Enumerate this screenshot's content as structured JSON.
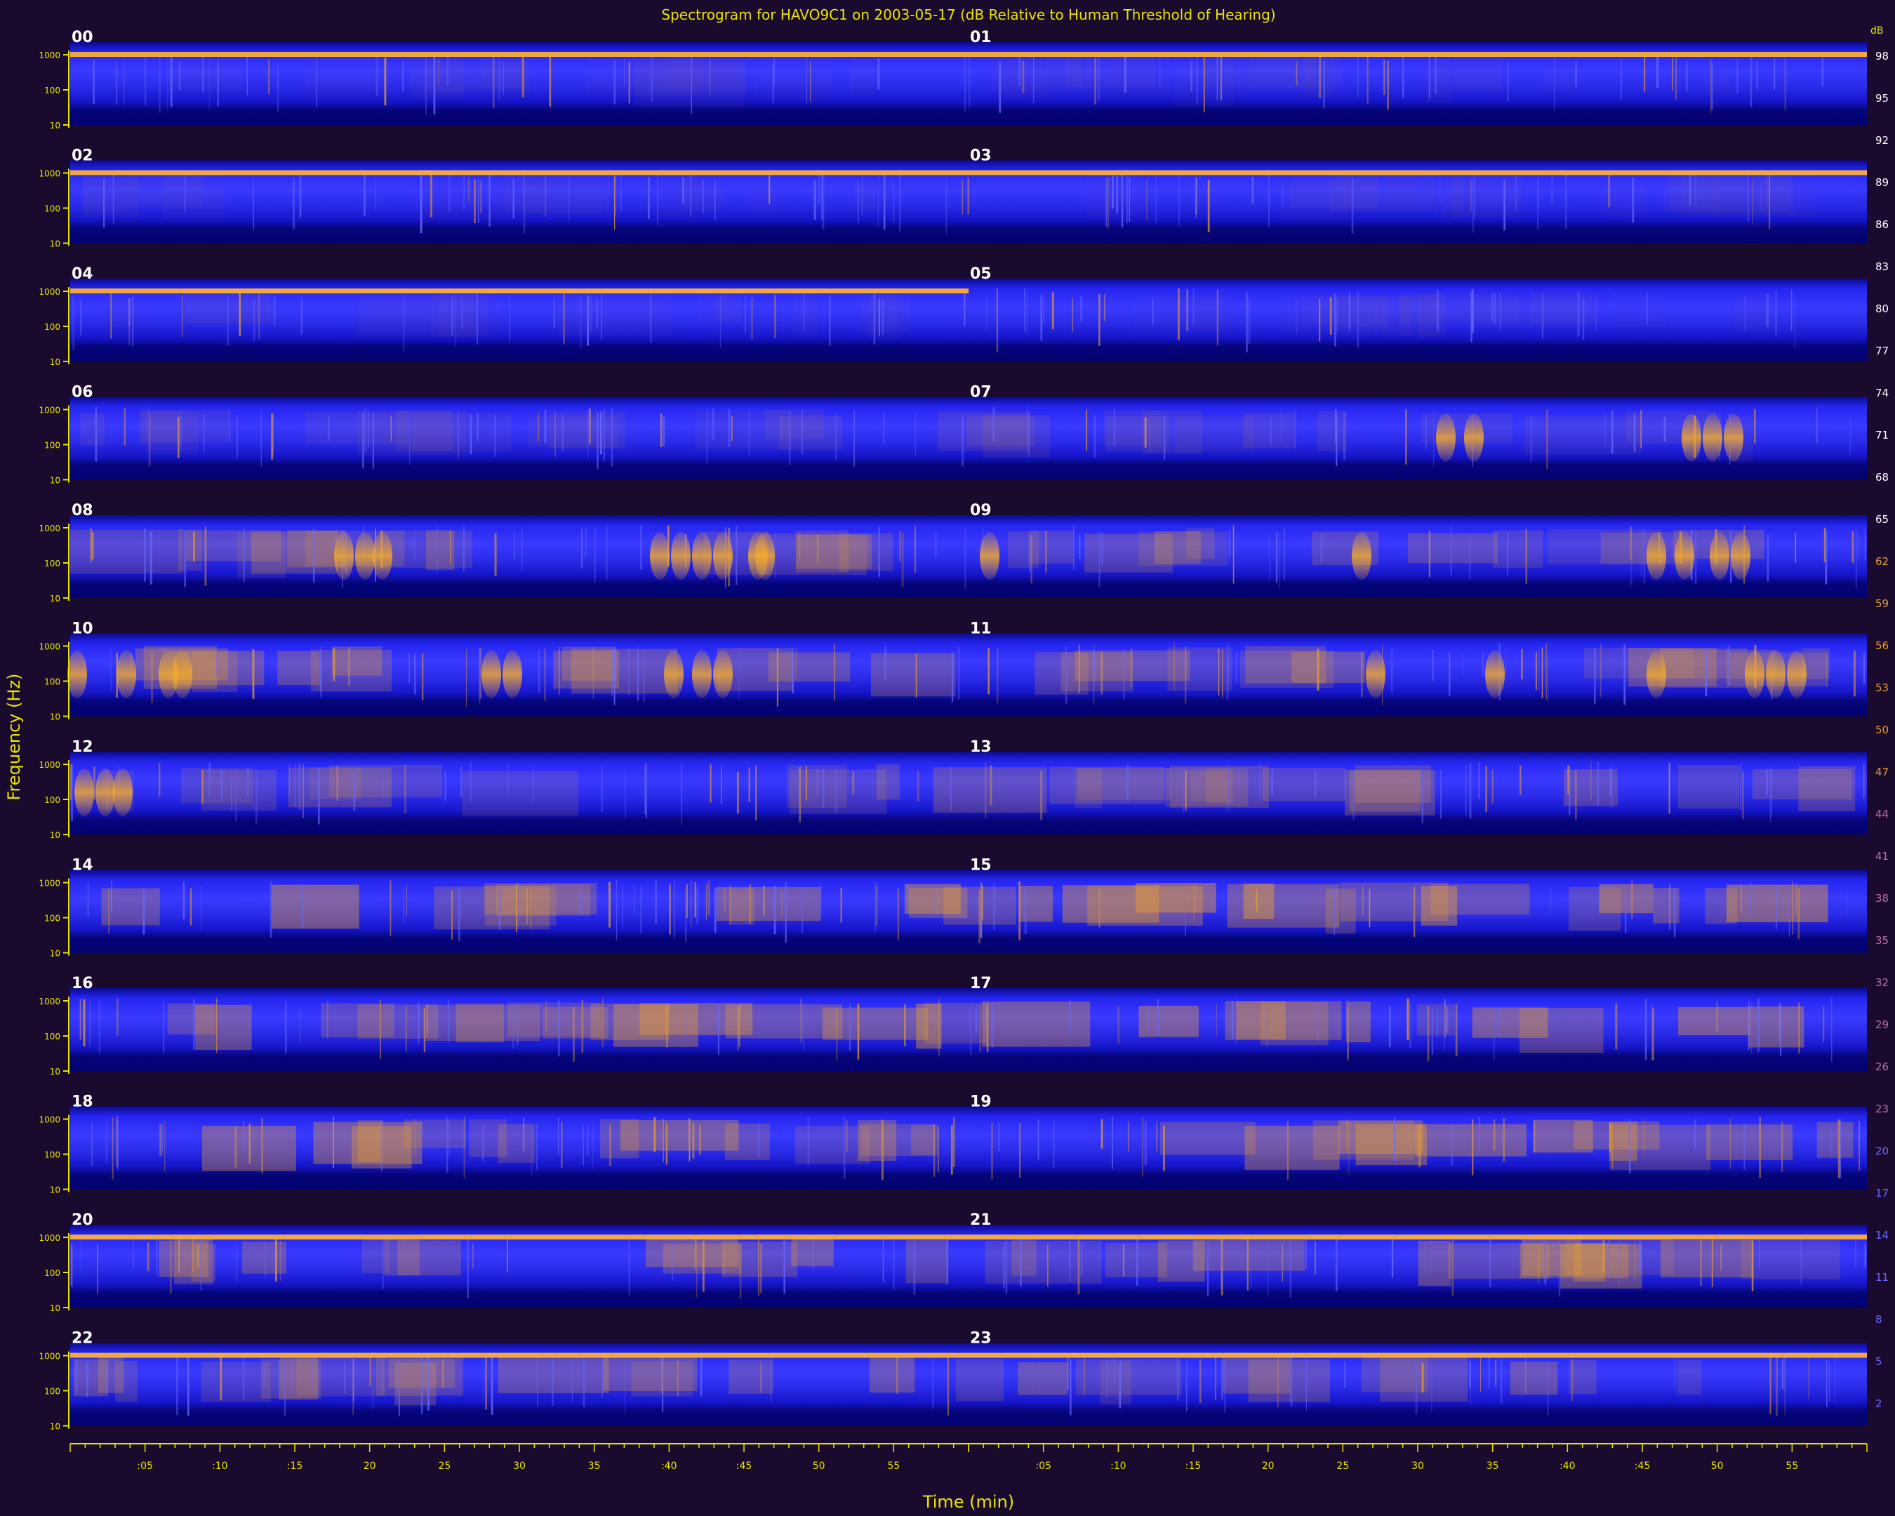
{
  "chart_data": {
    "type": "heatmap",
    "title": "Spectrogram for HAVO9C1 on 2003-05-17 (dB Relative to Human Threshold of Hearing)",
    "xlabel": "Time (min)",
    "ylabel": "Frequency (Hz)",
    "colorbar_unit": "dB",
    "colorbar_ticks": [
      98,
      95,
      92,
      89,
      86,
      83,
      80,
      77,
      74,
      71,
      68,
      65,
      62,
      59,
      56,
      53,
      50,
      47,
      44,
      41,
      38,
      35,
      32,
      29,
      26,
      23,
      20,
      17,
      14,
      11,
      8,
      5,
      2
    ],
    "y_tick_labels": [
      "1000",
      "100",
      "10"
    ],
    "x_tick_labels": [
      ":05",
      ":10",
      ":15",
      "20",
      "25",
      "30",
      "35",
      ":40",
      ":45",
      "50",
      "55"
    ],
    "hour_labels": [
      "00",
      "01",
      "02",
      "03",
      "04",
      "05",
      "06",
      "07",
      "08",
      "09",
      "10",
      "11",
      "12",
      "13",
      "14",
      "15",
      "16",
      "17",
      "18",
      "19",
      "20",
      "21",
      "22",
      "23"
    ],
    "tonal_line_hours": [
      "00",
      "01",
      "02",
      "03",
      "04",
      "20",
      "21",
      "22",
      "23"
    ],
    "grid": false,
    "colors": {
      "background": "#1a0a2e",
      "band_dark": "#000080",
      "band_mid": "#1010e0",
      "band_bright": "#3a3aff",
      "hot": "#e8a030",
      "axis": "#e6e600"
    }
  }
}
